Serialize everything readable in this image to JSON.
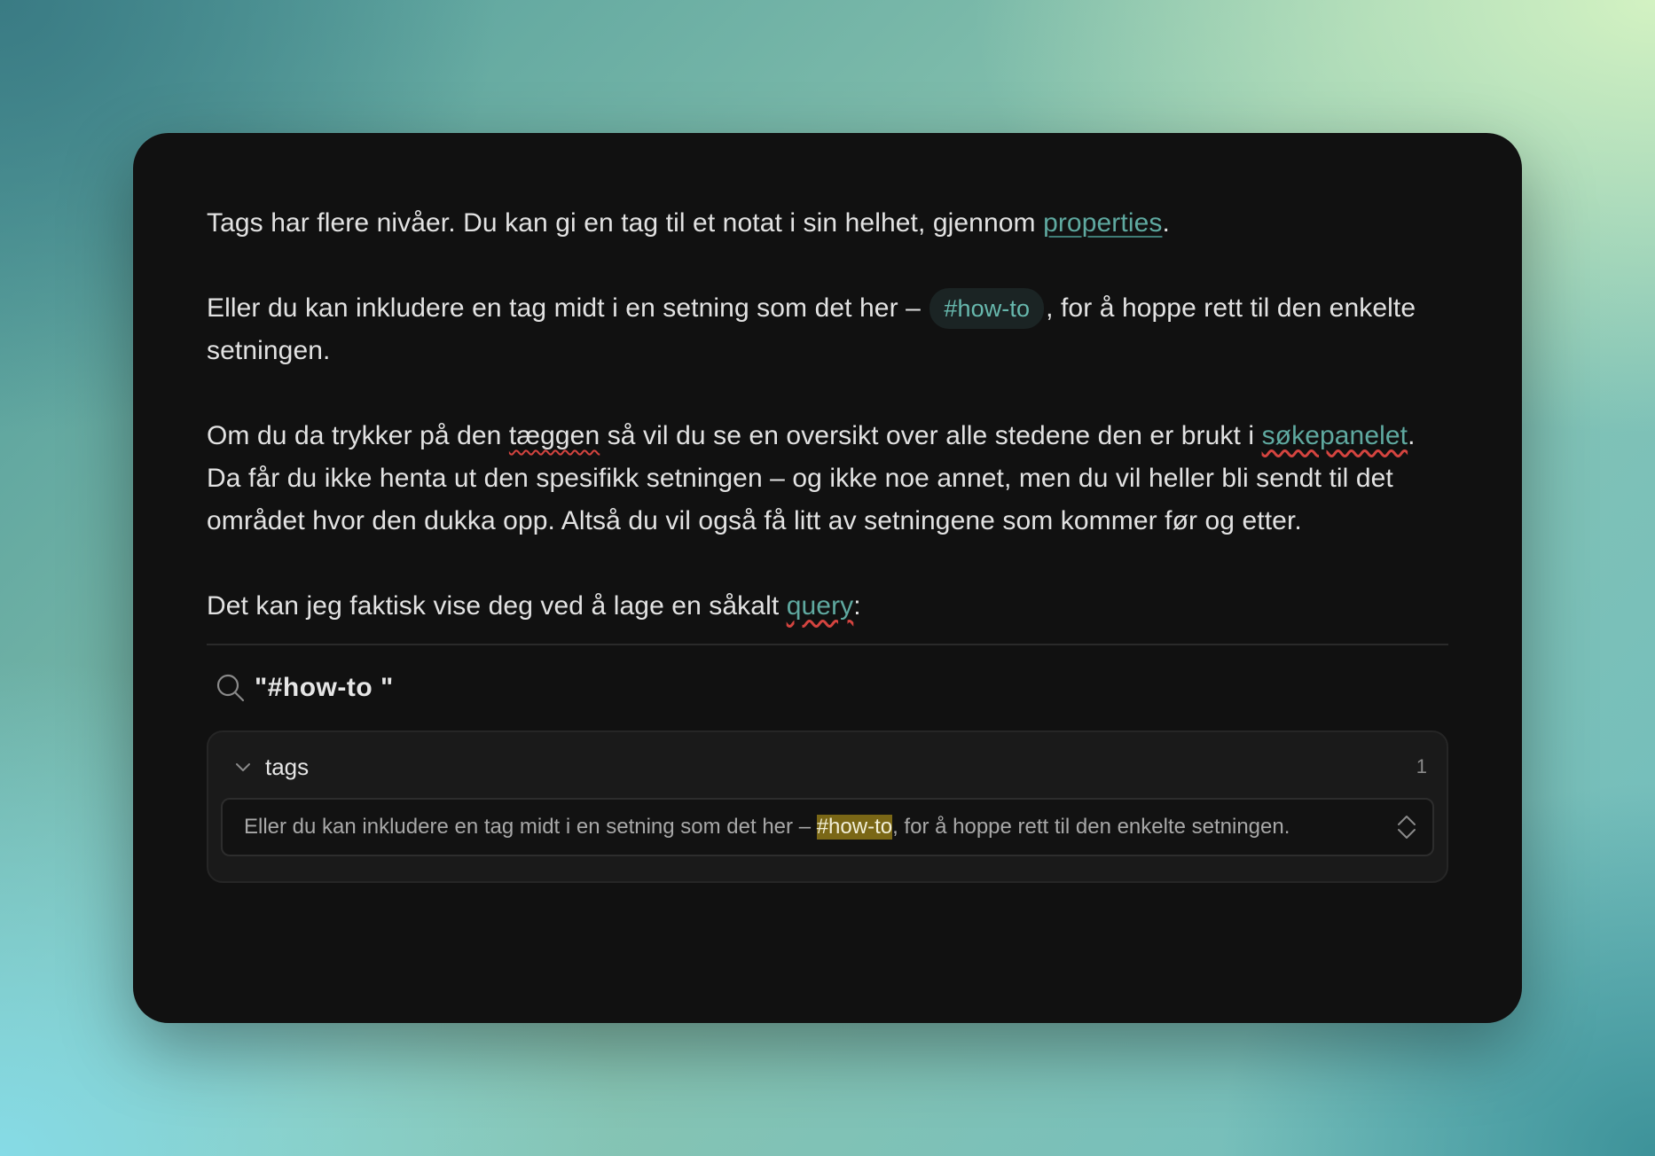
{
  "note": {
    "p1": {
      "before": "Tags har flere nivåer. Du kan gi en tag til et notat i sin helhet, gjennom ",
      "link": "properties",
      "after": "."
    },
    "p2": {
      "before": "Eller du kan inkludere en tag midt i en setning som det her – ",
      "tag": "#how-to",
      "after": ", for å hoppe rett til den enkelte setningen."
    },
    "p3": {
      "part1": "Om du da trykker på den ",
      "misspelled": "tæggen",
      "part2": " så vil du se en oversikt over alle stedene den er brukt i ",
      "link": "søkepanelet",
      "part3": ". Da får du ikke henta ut den spesifikk setningen – og ikke noe annet, men du vil heller bli sendt til det området hvor den dukka opp. Altså du vil også få litt av setningene som kommer før og etter."
    },
    "p4": {
      "before": "Det kan jeg faktisk vise deg ved å lage en såkalt ",
      "link": "query",
      "after": ":"
    }
  },
  "query": {
    "icon": "search-icon",
    "text": "\"#how-to \""
  },
  "results": {
    "group_label": "tags",
    "count": "1",
    "item": {
      "before": "Eller du kan inkludere en tag midt i en setning som det her – ",
      "match": "#how-to",
      "after": ", for å hoppe rett til den enkelte setningen."
    }
  },
  "colors": {
    "card_background": "#111111",
    "link": "#5fa9a0",
    "tag_text": "#67b8ad",
    "highlight": "#7a6716",
    "spellcheck": "#d4443f"
  }
}
